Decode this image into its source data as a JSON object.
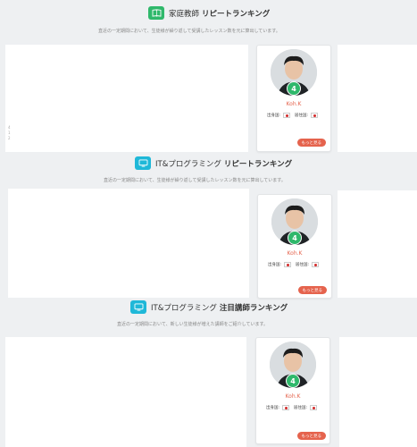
{
  "sections": [
    {
      "title_prefix": "家庭教師",
      "title_bold": "リピートランキング",
      "description": "直近の一定期間において、生徒様が繰り返して受講したレッスン数を元に算出しています。",
      "icon": "book-icon",
      "icon_color": "#2fb86b",
      "teacher": {
        "name": "Koh.K",
        "rank": "4",
        "lang1_label": "出身国:",
        "lang2_label": "居住国:",
        "more_label": "もっと見る"
      },
      "side_numbers": [
        "4",
        "1",
        "2"
      ]
    },
    {
      "title_prefix": "IT&プログラミング",
      "title_bold": "リピートランキング",
      "description": "直近の一定期間において、生徒様が繰り返して受講したレッスン数を元に算出しています。",
      "icon": "monitor-icon",
      "icon_color": "#1fb8d8",
      "teacher": {
        "name": "Koh.K",
        "rank": "4",
        "lang1_label": "出身国:",
        "lang2_label": "居住国:",
        "more_label": "もっと見る"
      }
    },
    {
      "title_prefix": "IT&プログラミング",
      "title_bold": "注目講師ランキング",
      "description": "直近の一定期間において、新しい生徒様が増えた講師をご紹介しています。",
      "icon": "monitor-icon",
      "icon_color": "#1fb8d8",
      "teacher": {
        "name": "Koh.K",
        "rank": "4",
        "lang1_label": "出身国:",
        "lang2_label": "居住国:",
        "more_label": "もっと見る"
      }
    }
  ]
}
